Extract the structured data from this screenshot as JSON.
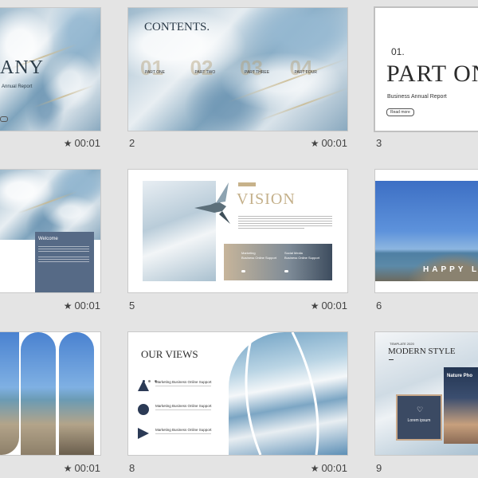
{
  "slides": [
    {
      "number": "",
      "time": "00:01",
      "title": "ANY",
      "subtitle": "Annual Report"
    },
    {
      "number": "2",
      "time": "00:01",
      "title": "CONTENTS.",
      "items": [
        {
          "num": "01",
          "label": "PART ONE"
        },
        {
          "num": "02",
          "label": "PART TWO"
        },
        {
          "num": "03",
          "label": "PART THREE"
        },
        {
          "num": "04",
          "label": "PART FOUR"
        }
      ]
    },
    {
      "number": "3",
      "time": "",
      "part_num": "01.",
      "title": "PART ON",
      "subtitle": "Business Annual Report",
      "button": "Read more"
    },
    {
      "number": "",
      "time": "00:01",
      "title": "Welcome"
    },
    {
      "number": "5",
      "time": "00:01",
      "title": "VISION",
      "card1_title": "Marketing",
      "card1_sub": "Business Online Support",
      "card2_title": "Social Media",
      "card2_sub": "Business Online Support"
    },
    {
      "number": "6",
      "time": "",
      "title": "HAPPY L"
    },
    {
      "number": "",
      "time": "00:01"
    },
    {
      "number": "8",
      "time": "00:01",
      "title": "OUR VIEWS",
      "items": [
        "Marketing Business Online Support",
        "Marketing Business Online Support",
        "Marketing Business Online Support"
      ]
    },
    {
      "number": "9",
      "time": "",
      "tag": "TEMPLATE 2020",
      "title": "MODERN STYLE",
      "card1": "Lorem ipsum",
      "card2": "Nature Pho"
    }
  ]
}
